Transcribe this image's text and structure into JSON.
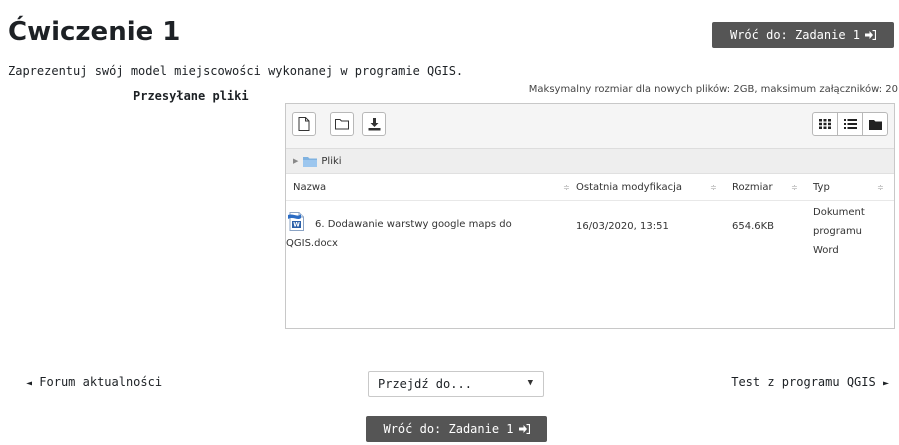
{
  "page": {
    "title": "Ćwiczenie 1",
    "back_button_label": "Wróć do: Zadanie 1",
    "intro_text": "Zaprezentuj swój model miejscowości wykonanej w programie QGIS."
  },
  "submission": {
    "files_label": "Przesyłane pliki",
    "max_size_info": "Maksymalny rozmiar dla nowych plików: 2GB, maksimum załączników: 20"
  },
  "filemanager": {
    "toolbar": {
      "add_file_icon": "file-icon",
      "create_folder_icon": "folder-icon",
      "download_icon": "download-icon",
      "view_icons": [
        "grid-icon",
        "list-icon",
        "folder-tree-icon"
      ]
    },
    "path": {
      "folder_name": "Pliki"
    },
    "columns": [
      "Nazwa",
      "Ostatnia modyfikacja",
      "Rozmiar",
      "Typ"
    ],
    "files": [
      {
        "icon": "word-document-icon",
        "name": "6. Dodawanie warstwy google maps do QGIS.docx",
        "modified": "16/03/2020, 13:51",
        "size": "654.6KB",
        "type": "Dokument programu Word"
      }
    ]
  },
  "navigation": {
    "prev_label": "Forum aktualności",
    "next_label": "Test z programu QGIS",
    "jump_select_value": "Przejdź do..."
  },
  "colors": {
    "dark_button": "#555555",
    "toolbar_bg": "#f5f5f5",
    "path_bg": "#eeeeee",
    "border": "#c8c8c8"
  }
}
